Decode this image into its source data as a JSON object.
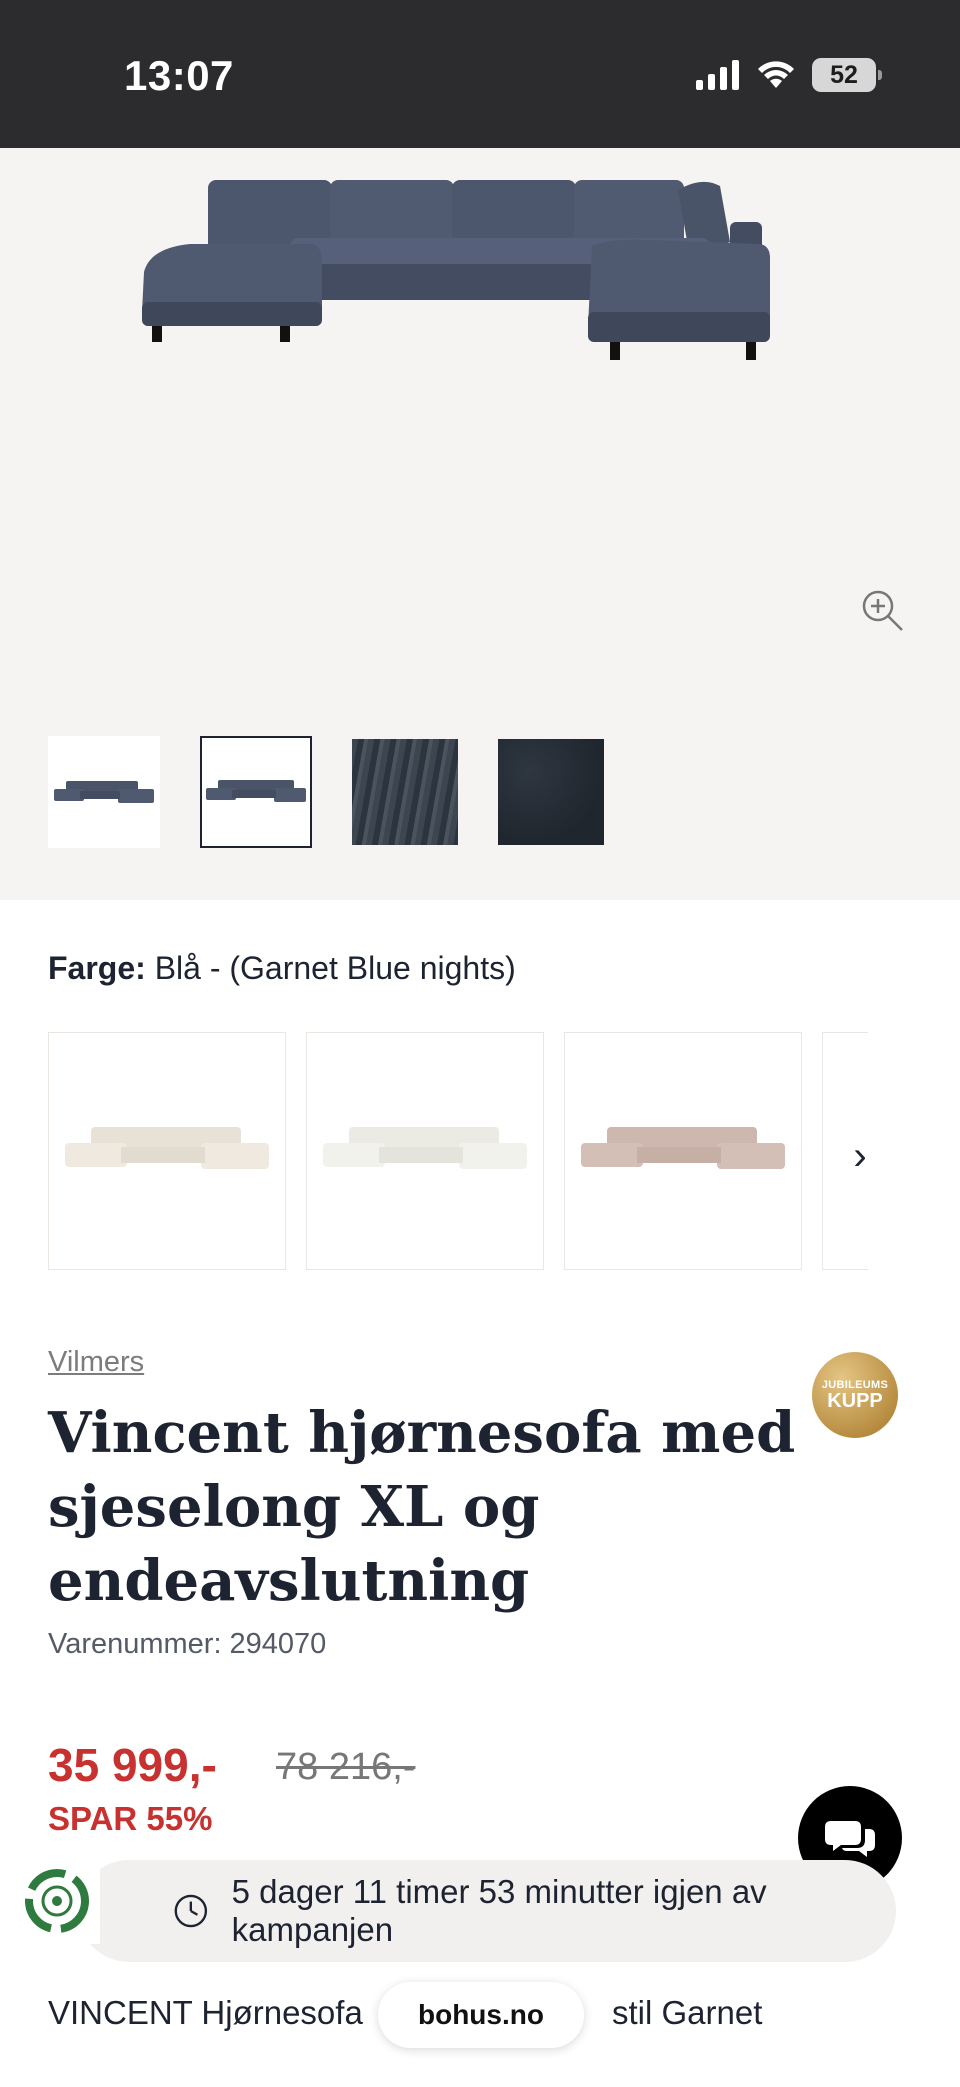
{
  "status_bar": {
    "time": "13:07",
    "battery": "52"
  },
  "gallery": {
    "thumbnails": [
      {
        "name": "sofa-angle"
      },
      {
        "name": "sofa-front",
        "selected": true
      },
      {
        "name": "fabric-closeup"
      },
      {
        "name": "fabric-swatch"
      }
    ]
  },
  "color": {
    "label": "Farge:",
    "value": "Blå - (Garnet Blue nights)"
  },
  "color_options": [
    "beige",
    "off-white",
    "rose"
  ],
  "product": {
    "brand": "Vilmers",
    "badge_top": "JUBILEUMS",
    "badge_main": "KUPP",
    "title": "Vincent hjørnesofa med sjeselong XL og endeavslutning",
    "sku_label": "Varenummer:",
    "sku": "294070",
    "price": "35 999,-",
    "old_price": "78 216,-",
    "savings": "SPAR 55%"
  },
  "campaign": {
    "text": "5 dager 11 timer 53 minutter igjen av kampanjen"
  },
  "description_preview": "VINCENT Hjørnesofa",
  "description_preview_tail": "stil Garnet",
  "browser": {
    "url": "bohus.no"
  },
  "colors": {
    "accent_red": "#c7312f",
    "text_dark": "#1d2330",
    "sofa_blue": "#48536a"
  }
}
